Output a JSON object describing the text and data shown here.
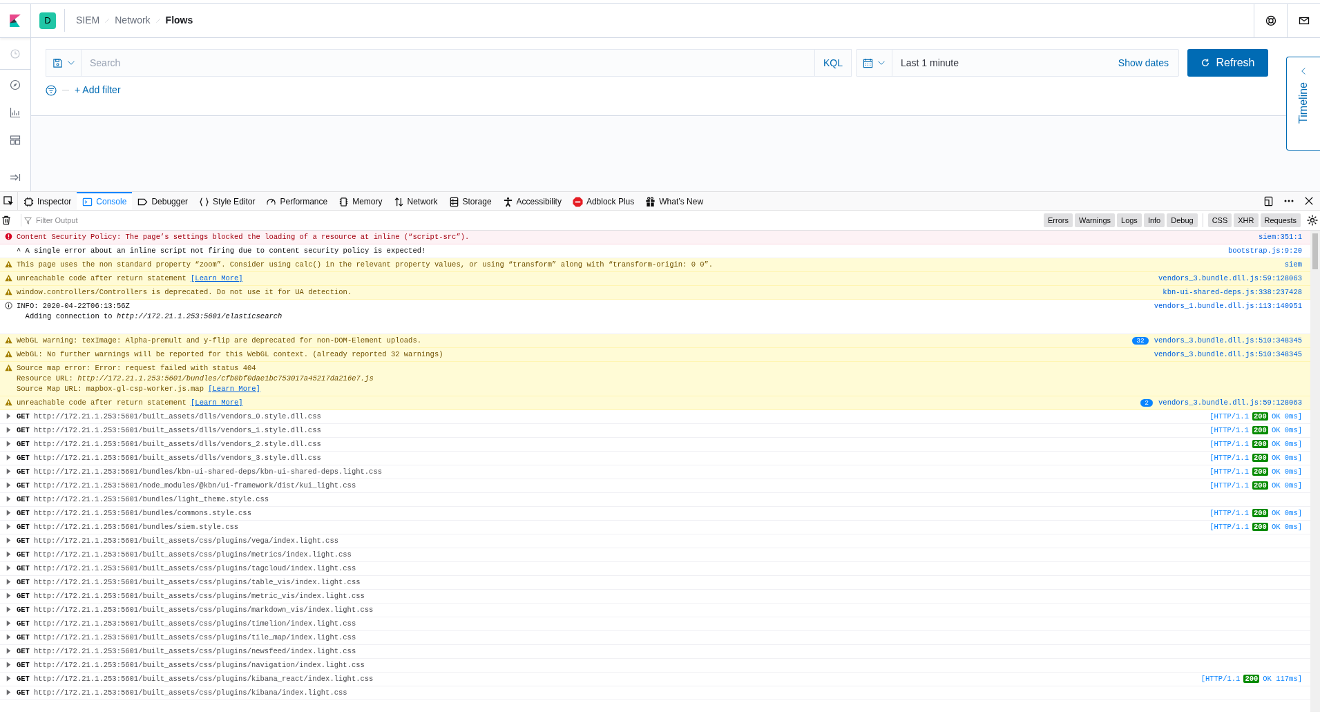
{
  "header": {
    "space": "D",
    "breadcrumbs": [
      {
        "label": "SIEM",
        "current": false
      },
      {
        "label": "Network",
        "current": false
      },
      {
        "label": "Flows",
        "current": true
      }
    ]
  },
  "query_bar": {
    "placeholder": "Search",
    "language": "KQL",
    "time": "Last 1 minute",
    "show_dates": "Show dates",
    "refresh": "Refresh"
  },
  "filter_bar": {
    "add": "+ Add filter"
  },
  "timeline_tab": "Timeline",
  "devtools": {
    "tabs": [
      {
        "label": "Inspector",
        "selected": false
      },
      {
        "label": "Console",
        "selected": true
      },
      {
        "label": "Debugger",
        "selected": false
      },
      {
        "label": "Style Editor",
        "selected": false
      },
      {
        "label": "Performance",
        "selected": false
      },
      {
        "label": "Memory",
        "selected": false
      },
      {
        "label": "Network",
        "selected": false
      },
      {
        "label": "Storage",
        "selected": false
      },
      {
        "label": "Accessibility",
        "selected": false
      },
      {
        "label": "Adblock Plus",
        "selected": false
      },
      {
        "label": "What’s New",
        "selected": false
      }
    ],
    "filter_placeholder": "Filter Output",
    "level_filters": [
      {
        "label": "Errors",
        "on": true
      },
      {
        "label": "Warnings",
        "on": true
      },
      {
        "label": "Logs",
        "on": true
      },
      {
        "label": "Info",
        "on": true
      },
      {
        "label": "Debug",
        "on": true
      }
    ],
    "type_filters": [
      {
        "label": "CSS",
        "on": true
      },
      {
        "label": "XHR",
        "on": true
      },
      {
        "label": "Requests",
        "on": true
      }
    ],
    "messages": [
      {
        "kind": "error",
        "lines": [
          "Content Security Policy: The page’s settings blocked the loading of a resource at inline (“script-src”)."
        ],
        "source": "siem:351:1"
      },
      {
        "kind": "log",
        "lines": [
          "^ A single error about an inline script not firing due to content security policy is expected!"
        ],
        "source": "bootstrap.js:9:20"
      },
      {
        "kind": "warning",
        "lines": [
          "This page uses the non standard property “zoom”. Consider using calc() in the relevant property values, or using “transform” along with “transform-origin: 0 0”."
        ],
        "source": "siem"
      },
      {
        "kind": "warning",
        "lines": [
          "unreachable code after return statement"
        ],
        "link": "[Learn More]",
        "source": "vendors_3.bundle.dll.js:59:128063"
      },
      {
        "kind": "warning",
        "lines": [
          "window.controllers/Controllers is deprecated. Do not use it for UA detection."
        ],
        "source": "kbn-ui-shared-deps.js:338:237428"
      },
      {
        "kind": "info",
        "lines": [
          "INFO: 2020-04-22T06:13:56Z",
          "  Adding connection to *http://172.21.1.253:5601/elasticsearch*"
        ],
        "source": "vendors_1.bundle.dll.js:113:140951"
      },
      {
        "kind": "warning",
        "lines": [
          "WebGL warning: texImage: Alpha-premult and y-flip are deprecated for non-DOM-Element uploads."
        ],
        "count": "32",
        "source": "vendors_3.bundle.dll.js:510:348345"
      },
      {
        "kind": "warning",
        "lines": [
          "WebGL: No further warnings will be reported for this WebGL context. (already reported 32 warnings)"
        ],
        "source": "vendors_3.bundle.dll.js:510:348345"
      },
      {
        "kind": "warning",
        "lines": [
          "Source map error: Error: request failed with status 404",
          "Resource URL: *http://172.21.1.253:5601/bundles/cfb0bf0dae1bc753017a45217da216e7.js*",
          "Source Map URL: mapbox-gl-csp-worker.js.map"
        ],
        "link": "[Learn More]"
      },
      {
        "kind": "warning",
        "lines": [
          "unreachable code after return statement"
        ],
        "link": "[Learn More]",
        "count": "2",
        "source": "vendors_3.bundle.dll.js:59:128063"
      },
      {
        "kind": "network",
        "method": "GET",
        "url": "http://172.21.1.253:5601/built_assets/dlls/vendors_0.style.dll.css",
        "status": {
          "protocol": "[HTTP/1.1",
          "code": "200",
          "text": "OK 0ms]"
        }
      },
      {
        "kind": "network",
        "method": "GET",
        "url": "http://172.21.1.253:5601/built_assets/dlls/vendors_1.style.dll.css",
        "status": {
          "protocol": "[HTTP/1.1",
          "code": "200",
          "text": "OK 0ms]"
        }
      },
      {
        "kind": "network",
        "method": "GET",
        "url": "http://172.21.1.253:5601/built_assets/dlls/vendors_2.style.dll.css",
        "status": {
          "protocol": "[HTTP/1.1",
          "code": "200",
          "text": "OK 0ms]"
        }
      },
      {
        "kind": "network",
        "method": "GET",
        "url": "http://172.21.1.253:5601/built_assets/dlls/vendors_3.style.dll.css",
        "status": {
          "protocol": "[HTTP/1.1",
          "code": "200",
          "text": "OK 0ms]"
        }
      },
      {
        "kind": "network",
        "method": "GET",
        "url": "http://172.21.1.253:5601/bundles/kbn-ui-shared-deps/kbn-ui-shared-deps.light.css",
        "status": {
          "protocol": "[HTTP/1.1",
          "code": "200",
          "text": "OK 0ms]"
        }
      },
      {
        "kind": "network",
        "method": "GET",
        "url": "http://172.21.1.253:5601/node_modules/@kbn/ui-framework/dist/kui_light.css",
        "status": {
          "protocol": "[HTTP/1.1",
          "code": "200",
          "text": "OK 0ms]"
        }
      },
      {
        "kind": "network",
        "method": "GET",
        "url": "http://172.21.1.253:5601/bundles/light_theme.style.css"
      },
      {
        "kind": "network",
        "method": "GET",
        "url": "http://172.21.1.253:5601/bundles/commons.style.css",
        "status": {
          "protocol": "[HTTP/1.1",
          "code": "200",
          "text": "OK 0ms]"
        }
      },
      {
        "kind": "network",
        "method": "GET",
        "url": "http://172.21.1.253:5601/bundles/siem.style.css",
        "status": {
          "protocol": "[HTTP/1.1",
          "code": "200",
          "text": "OK 0ms]"
        }
      },
      {
        "kind": "network",
        "method": "GET",
        "url": "http://172.21.1.253:5601/built_assets/css/plugins/vega/index.light.css"
      },
      {
        "kind": "network",
        "method": "GET",
        "url": "http://172.21.1.253:5601/built_assets/css/plugins/metrics/index.light.css"
      },
      {
        "kind": "network",
        "method": "GET",
        "url": "http://172.21.1.253:5601/built_assets/css/plugins/tagcloud/index.light.css"
      },
      {
        "kind": "network",
        "method": "GET",
        "url": "http://172.21.1.253:5601/built_assets/css/plugins/table_vis/index.light.css"
      },
      {
        "kind": "network",
        "method": "GET",
        "url": "http://172.21.1.253:5601/built_assets/css/plugins/metric_vis/index.light.css"
      },
      {
        "kind": "network",
        "method": "GET",
        "url": "http://172.21.1.253:5601/built_assets/css/plugins/markdown_vis/index.light.css"
      },
      {
        "kind": "network",
        "method": "GET",
        "url": "http://172.21.1.253:5601/built_assets/css/plugins/timelion/index.light.css"
      },
      {
        "kind": "network",
        "method": "GET",
        "url": "http://172.21.1.253:5601/built_assets/css/plugins/tile_map/index.light.css"
      },
      {
        "kind": "network",
        "method": "GET",
        "url": "http://172.21.1.253:5601/built_assets/css/plugins/newsfeed/index.light.css"
      },
      {
        "kind": "network",
        "method": "GET",
        "url": "http://172.21.1.253:5601/built_assets/css/plugins/navigation/index.light.css"
      },
      {
        "kind": "network",
        "method": "GET",
        "url": "http://172.21.1.253:5601/built_assets/css/plugins/kibana_react/index.light.css",
        "status": {
          "protocol": "[HTTP/1.1",
          "code": "200",
          "text": "OK 117ms]"
        }
      },
      {
        "kind": "network",
        "method": "GET",
        "url": "http://172.21.1.253:5601/built_assets/css/plugins/kibana/index.light.css"
      }
    ]
  }
}
